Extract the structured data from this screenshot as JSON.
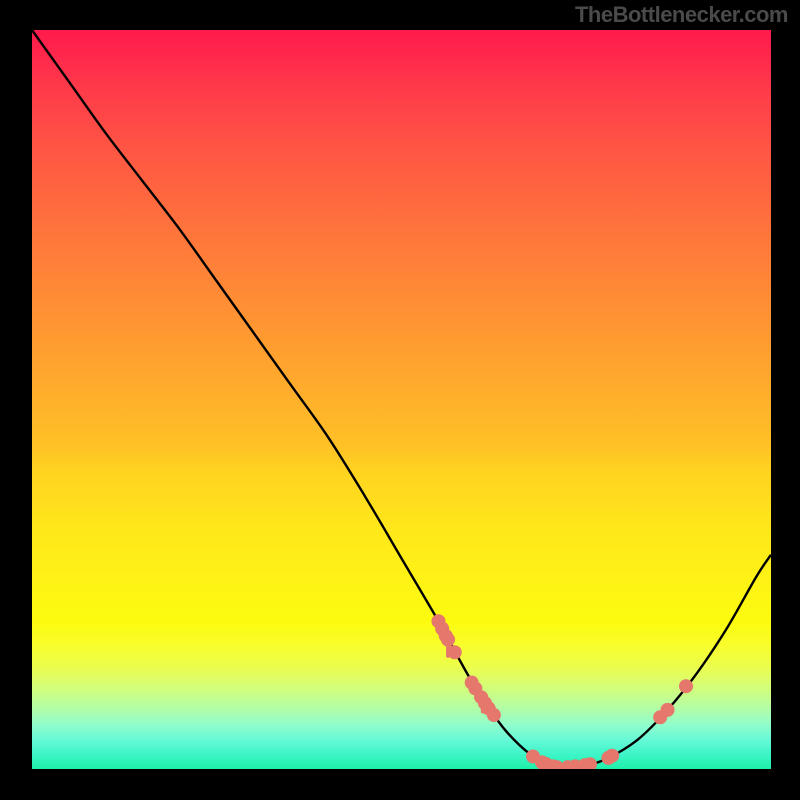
{
  "watermark": "TheBottlenecker.com",
  "chart_data": {
    "type": "line",
    "title": "",
    "xlabel": "",
    "ylabel": "",
    "xlim": [
      0,
      100
    ],
    "ylim": [
      0,
      100
    ],
    "curve": {
      "x": [
        0,
        5,
        10,
        15,
        20,
        25,
        30,
        35,
        40,
        45,
        50,
        55,
        58,
        60,
        62,
        64,
        66,
        68,
        70,
        72,
        75,
        78,
        82,
        86,
        90,
        94,
        98,
        100
      ],
      "y": [
        100,
        93,
        86,
        79.5,
        73,
        66,
        59,
        52,
        45,
        37,
        28.5,
        20,
        14.5,
        11,
        8,
        5.3,
        3.2,
        1.6,
        0.6,
        0.2,
        0.5,
        1.5,
        4,
        8,
        13,
        19,
        26,
        29
      ]
    },
    "markers": [
      {
        "x": 55.0,
        "y": 20.0
      },
      {
        "x": 55.5,
        "y": 19.0
      },
      {
        "x": 56.0,
        "y": 18.0
      },
      {
        "x": 56.3,
        "y": 17.5
      },
      {
        "x": 57.2,
        "y": 15.8
      },
      {
        "x": 59.5,
        "y": 11.7
      },
      {
        "x": 60.0,
        "y": 10.9
      },
      {
        "x": 60.8,
        "y": 9.7
      },
      {
        "x": 61.3,
        "y": 8.9
      },
      {
        "x": 61.8,
        "y": 8.2
      },
      {
        "x": 62.5,
        "y": 7.3
      },
      {
        "x": 67.8,
        "y": 1.7
      },
      {
        "x": 69.0,
        "y": 0.9
      },
      {
        "x": 69.5,
        "y": 0.7
      },
      {
        "x": 70.5,
        "y": 0.35
      },
      {
        "x": 71.0,
        "y": 0.25
      },
      {
        "x": 72.5,
        "y": 0.25
      },
      {
        "x": 73.5,
        "y": 0.35
      },
      {
        "x": 74.8,
        "y": 0.5
      },
      {
        "x": 75.5,
        "y": 0.65
      },
      {
        "x": 78.0,
        "y": 1.5
      },
      {
        "x": 78.5,
        "y": 1.8
      },
      {
        "x": 85.0,
        "y": 7.0
      },
      {
        "x": 86.0,
        "y": 8.0
      },
      {
        "x": 88.5,
        "y": 11.2
      }
    ],
    "drips": [
      {
        "x": 55.2,
        "y_top": 19.6,
        "len": 1.3
      },
      {
        "x": 56.3,
        "y_top": 17.5,
        "len": 2.2
      },
      {
        "x": 60.1,
        "y_top": 10.8,
        "len": 1.2
      },
      {
        "x": 61.0,
        "y_top": 9.4,
        "len": 1.6
      }
    ],
    "colors": {
      "curve": "#000000",
      "marker_fill": "#e5776c",
      "marker_stroke": "#e5776c"
    }
  }
}
